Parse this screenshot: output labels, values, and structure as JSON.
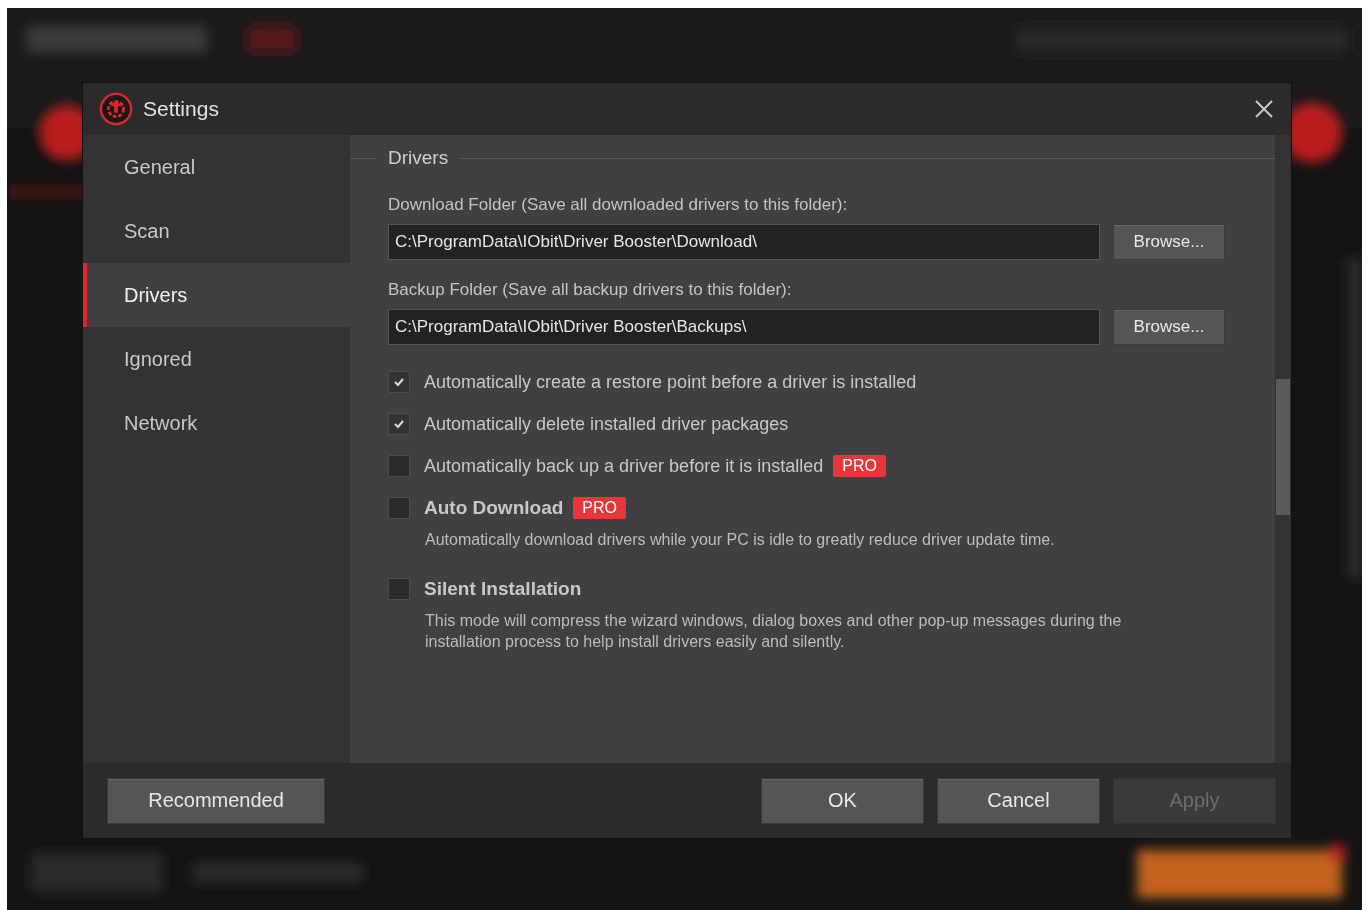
{
  "window": {
    "title": "Settings"
  },
  "sidebar": {
    "items": [
      {
        "label": "General",
        "selected": false
      },
      {
        "label": "Scan",
        "selected": false
      },
      {
        "label": "Drivers",
        "selected": true
      },
      {
        "label": "Ignored",
        "selected": false
      },
      {
        "label": "Network",
        "selected": false
      }
    ]
  },
  "section": {
    "title": "Drivers"
  },
  "folders": [
    {
      "label": "Download Folder (Save all downloaded drivers to this folder):",
      "value": "C:\\ProgramData\\IObit\\Driver Booster\\Download\\",
      "button": "Browse..."
    },
    {
      "label": "Backup Folder (Save all backup drivers to this folder):",
      "value": "C:\\ProgramData\\IObit\\Driver Booster\\Backups\\",
      "button": "Browse..."
    }
  ],
  "options": [
    {
      "kind": "simple",
      "label": "Automatically create a restore point before a driver is installed",
      "checked": true
    },
    {
      "kind": "simple",
      "label": "Automatically delete installed driver packages",
      "checked": true
    },
    {
      "kind": "simple",
      "label": "Automatically back up a driver before it is installed",
      "checked": false,
      "badge": "PRO"
    },
    {
      "kind": "feature",
      "label": "Auto Download",
      "checked": false,
      "badge": "PRO",
      "description": "Automatically download drivers while your PC is idle to greatly reduce driver update time."
    },
    {
      "kind": "feature",
      "label": "Silent Installation",
      "checked": false,
      "description": "This mode will compress the wizard windows, dialog boxes and other pop-up messages during the installation process to help install drivers easily and silently."
    }
  ],
  "footer": {
    "left_button": "Recommended",
    "buttons": [
      {
        "label": "OK",
        "disabled": false
      },
      {
        "label": "Cancel",
        "disabled": false
      },
      {
        "label": "Apply",
        "disabled": true
      }
    ]
  }
}
